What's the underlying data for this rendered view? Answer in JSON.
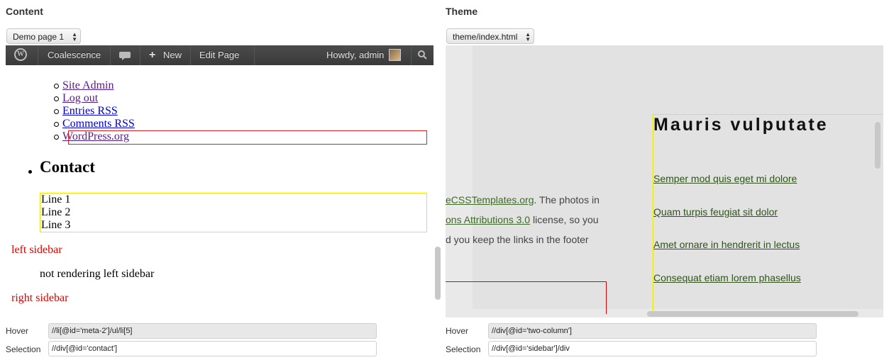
{
  "content_pane": {
    "title": "Content",
    "page_select": "Demo page 1",
    "adminbar": {
      "site_name": "Coalescence",
      "new_label": "New",
      "edit_label": "Edit Page",
      "howdy": "Howdy, admin"
    },
    "meta_links": [
      {
        "label": "Site Admin"
      },
      {
        "label": "Log out"
      },
      {
        "label": "Entries RSS"
      },
      {
        "label": "Comments RSS"
      },
      {
        "label": "WordPress.org"
      }
    ],
    "contact_heading": "Contact",
    "contact_lines": [
      "Line 1",
      "Line 2",
      "Line 3"
    ],
    "left_sidebar_label": "left sidebar",
    "left_sidebar_note": "not rendering left sidebar",
    "right_sidebar_label": "right sidebar"
  },
  "theme_pane": {
    "title": "Theme",
    "theme_select": "theme/index.html",
    "text_lines": {
      "line1_link": "eCSSTemplates.org",
      "line1_rest": ". The photos in",
      "line2_link": "ons Attributions 3.0",
      "line2_rest": " license, so you",
      "line3": "d you keep the links in the footer"
    },
    "sidebar_title": "Mauris vulputate",
    "sidebar_links": [
      "Semper mod quis eget mi dolore",
      "Quam turpis feugiat sit dolor",
      "Amet ornare in hendrerit in lectus",
      "Consequat etiam lorem phasellus"
    ]
  },
  "fields": {
    "content_hover_label": "Hover",
    "content_hover_value": "//li[@id='meta-2']/ul/li[5]",
    "content_selection_label": "Selection",
    "content_selection_value": "//div[@id='contact']",
    "theme_hover_label": "Hover",
    "theme_hover_value": "//div[@id='two-column']",
    "theme_selection_label": "Selection",
    "theme_selection_value": "//div[@id='sidebar']/div"
  },
  "colors": {
    "hover_outline": "#e02020",
    "selection_outline": "#f0e800",
    "adminbar": "#464646",
    "theme_link": "#3d6b25"
  }
}
